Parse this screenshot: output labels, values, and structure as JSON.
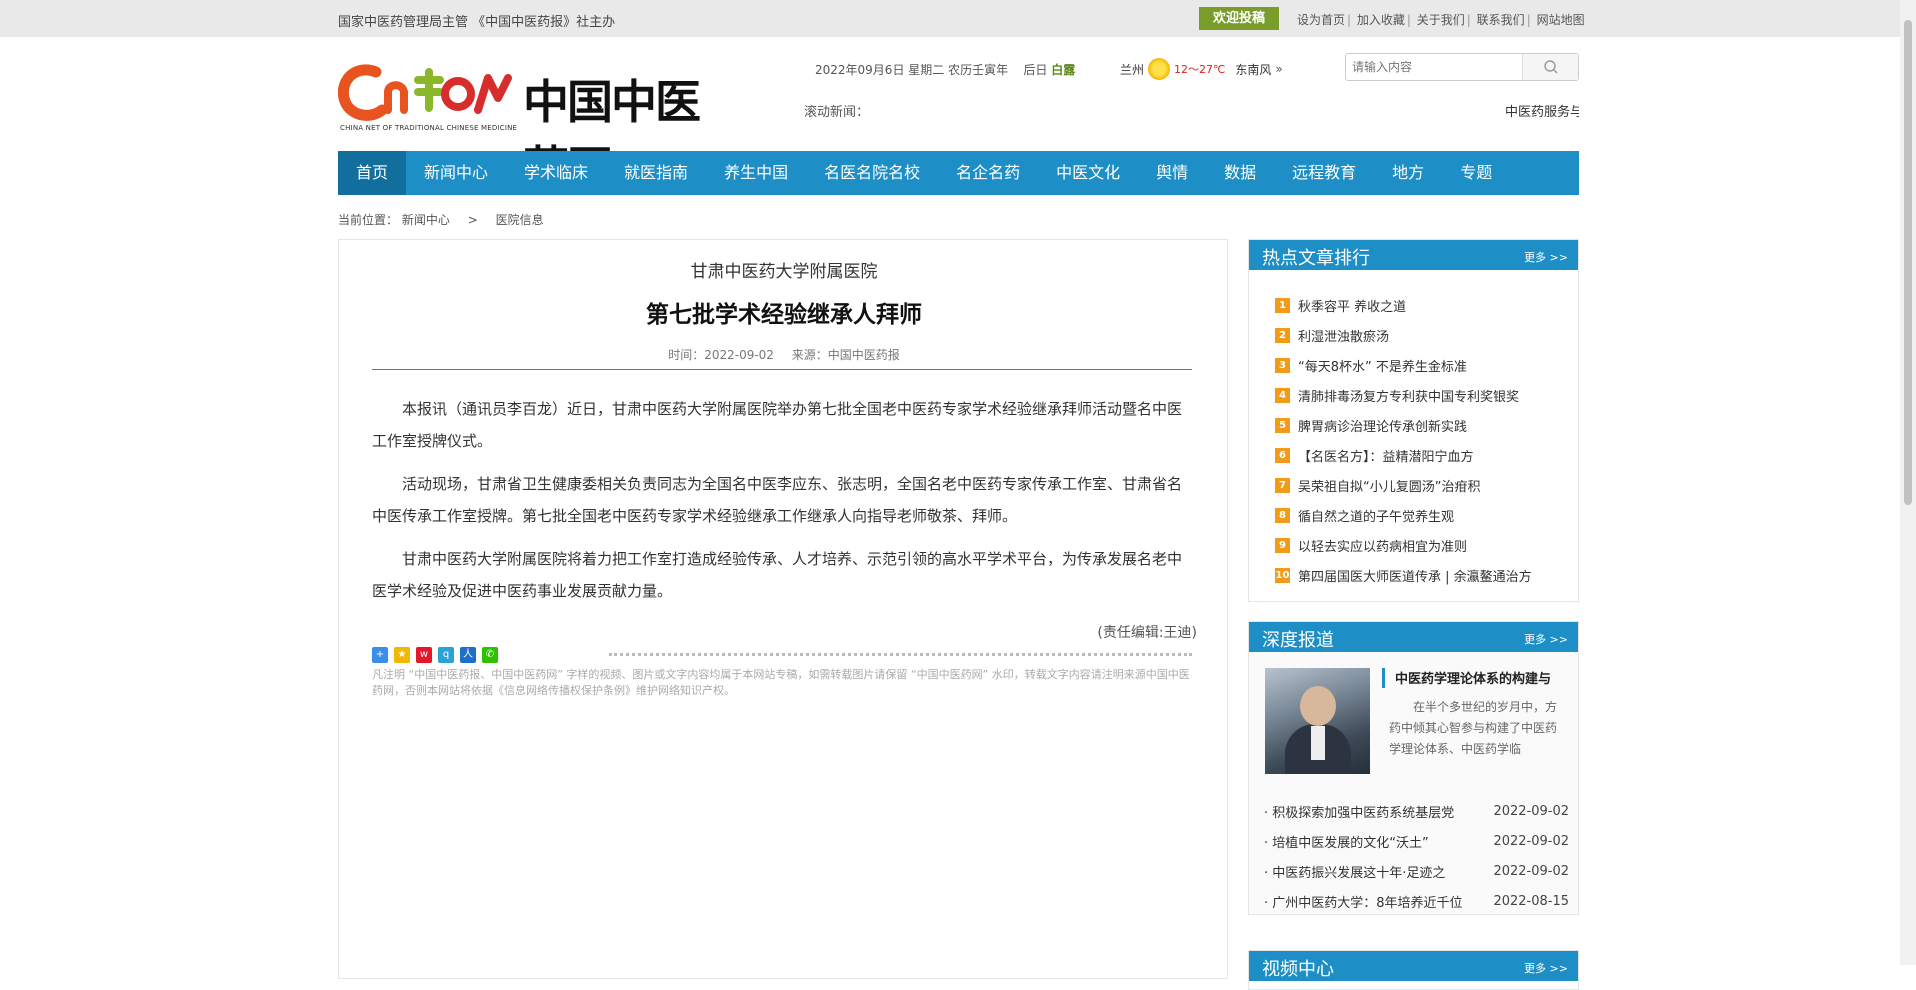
{
  "topbar": {
    "left_text": "国家中医药管理局主管 《中国中医药报》社主办",
    "submit_button": "欢迎投稿",
    "links": [
      "设为首页",
      "加入收藏",
      "关于我们",
      "联系我们",
      "网站地图"
    ]
  },
  "header": {
    "logo_cn_text": "中国中医药网",
    "logo_en_text": "CHINA NET OF TRADITIONAL CHINESE MEDICINE",
    "date": "2022年09月6日 星期二 农历壬寅年",
    "jieqi_label": "后日",
    "jieqi_value": "白露",
    "weather_city": "兰州",
    "weather_temp": "12～27℃",
    "weather_wind": "东南风",
    "search_placeholder": "请输入内容",
    "scroll_label": "滚动新闻：",
    "scroll_text": "中医药服务与"
  },
  "nav": [
    "首页",
    "新闻中心",
    "学术临床",
    "就医指南",
    "养生中国",
    "名医名院名校",
    "名企名药",
    "中医文化",
    "舆情",
    "数据",
    "远程教育",
    "地方",
    "专题"
  ],
  "breadcrumb": {
    "label": "当前位置：",
    "level1": "新闻中心",
    "separator": ">",
    "level2": "医院信息"
  },
  "article": {
    "subtitle": "甘肃中医药大学附属医院",
    "title": "第七批学术经验继承人拜师",
    "time": "时间：2022-09-02",
    "source": "来源：中国中医药报",
    "paragraphs": [
      "本报讯（通讯员李百龙）近日，甘肃中医药大学附属医院举办第七批全国老中医药专家学术经验继承拜师活动暨名中医工作室授牌仪式。",
      "活动现场，甘肃省卫生健康委相关负责同志为全国名中医李应东、张志明，全国名老中医药专家传承工作室、甘肃省名中医传承工作室授牌。第七批全国老中医药专家学术经验继承工作继承人向指导老师敬茶、拜师。",
      "甘肃中医药大学附属医院将着力把工作室打造成经验传承、人才培养、示范引领的高水平学术平台，为传承发展名老中医学术经验及促进中医药事业发展贡献力量。"
    ],
    "editor": "(责任编辑:王迪)",
    "disclaimer": "凡注明 “中国中医药报、中国中医药网” 字样的视频、图片或文字内容均属于本网站专稿，如需转载图片请保留 “中国中医药网” 水印，转载文字内容请注明来源中国中医药网，否则本网站将依据《信息网络传播权保护条例》维护网络知识产权。"
  },
  "hot": {
    "title": "热点文章排行",
    "more": "更多 >>",
    "items": [
      {
        "n": "1",
        "t": "秋季容平 养收之道"
      },
      {
        "n": "2",
        "t": "利湿泄浊散瘀汤"
      },
      {
        "n": "3",
        "t": "“每天8杯水” 不是养生金标准"
      },
      {
        "n": "4",
        "t": "清肺排毒汤复方专利获中国专利奖银奖"
      },
      {
        "n": "5",
        "t": "脾胃病诊治理论传承创新实践"
      },
      {
        "n": "6",
        "t": "【名医名方】：益精潜阳宁血方"
      },
      {
        "n": "7",
        "t": "吴荣祖自拟“小儿复圆汤”治疳积"
      },
      {
        "n": "8",
        "t": "循自然之道的子午觉养生观"
      },
      {
        "n": "9",
        "t": "以轻去实应以药病相宜为准则"
      },
      {
        "n": "10",
        "t": "第四届国医大师医道传承 | 余瀛鳌通治方"
      }
    ]
  },
  "deep": {
    "title": "深度报道",
    "more": "更多 >>",
    "feature_title": "中医药学理论体系的构建与",
    "feature_desc": "在半个多世纪的岁月中，方药中倾其心智参与构建了中医药学理论体系、中医药学临",
    "items": [
      {
        "t": "积极探索加强中医药系统基层党",
        "d": "2022-09-02"
      },
      {
        "t": "培植中医发展的文化“沃土”",
        "d": "2022-09-02"
      },
      {
        "t": "中医药振兴发展这十年·足迹之",
        "d": "2022-09-02"
      },
      {
        "t": "广州中医药大学：8年培养近千位",
        "d": "2022-08-15"
      }
    ]
  },
  "video": {
    "title": "视频中心",
    "more": "更多 >>"
  }
}
